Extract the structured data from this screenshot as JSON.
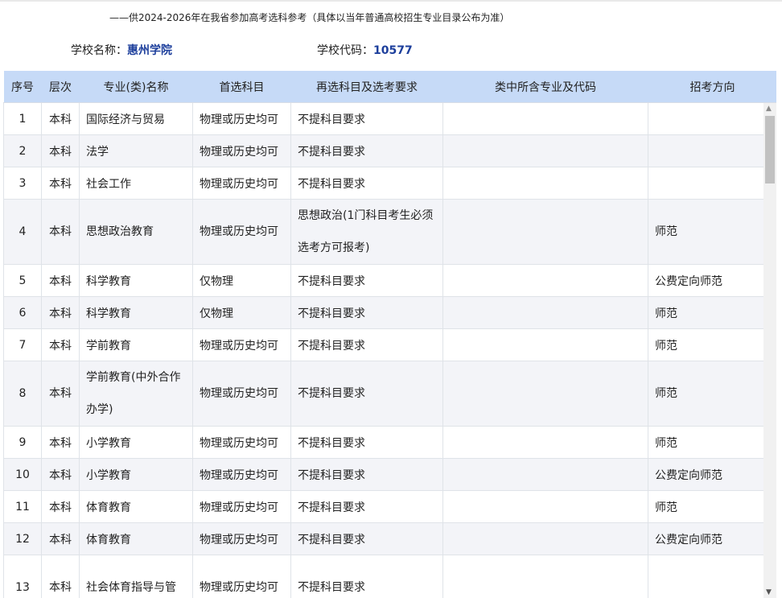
{
  "subtitle": "——供2024-2026年在我省参加高考选科参考（具体以当年普通高校招生专业目录公布为准）",
  "school": {
    "name_label": "学校名称：",
    "name": "惠州学院",
    "code_label": "学校代码：",
    "code": "10577"
  },
  "table": {
    "headers": [
      "序号",
      "层次",
      "专业(类)名称",
      "首选科目",
      "再选科目及选考要求",
      "类中所含专业及代码",
      "招考方向"
    ],
    "rows": [
      [
        "1",
        "本科",
        "国际经济与贸易",
        "物理或历史均可",
        "不提科目要求",
        "",
        ""
      ],
      [
        "2",
        "本科",
        "法学",
        "物理或历史均可",
        "不提科目要求",
        "",
        ""
      ],
      [
        "3",
        "本科",
        "社会工作",
        "物理或历史均可",
        "不提科目要求",
        "",
        ""
      ],
      [
        "4",
        "本科",
        "思想政治教育",
        "物理或历史均可",
        "思想政治(1门科目考生必须选考方可报考)",
        "",
        "师范"
      ],
      [
        "5",
        "本科",
        "科学教育",
        "仅物理",
        "不提科目要求",
        "",
        "公费定向师范"
      ],
      [
        "6",
        "本科",
        "科学教育",
        "仅物理",
        "不提科目要求",
        "",
        "师范"
      ],
      [
        "7",
        "本科",
        "学前教育",
        "物理或历史均可",
        "不提科目要求",
        "",
        "师范"
      ],
      [
        "8",
        "本科",
        "学前教育(中外合作办学)",
        "物理或历史均可",
        "不提科目要求",
        "",
        "师范"
      ],
      [
        "9",
        "本科",
        "小学教育",
        "物理或历史均可",
        "不提科目要求",
        "",
        "师范"
      ],
      [
        "10",
        "本科",
        "小学教育",
        "物理或历史均可",
        "不提科目要求",
        "",
        "公费定向师范"
      ],
      [
        "11",
        "本科",
        "体育教育",
        "物理或历史均可",
        "不提科目要求",
        "",
        "师范"
      ],
      [
        "12",
        "本科",
        "体育教育",
        "物理或历史均可",
        "不提科目要求",
        "",
        "公费定向师范"
      ],
      [
        "13",
        "本科",
        "社会体育指导与管",
        "物理或历史均可",
        "不提科目要求",
        "",
        ""
      ]
    ]
  },
  "icons": {
    "scroll_up": "triangle-up-icon",
    "scroll_down": "triangle-down-icon"
  },
  "colors": {
    "header_bg": "#c6daf7",
    "accent_text": "#1d3f9c",
    "alt_row_bg": "#f3f4f8"
  }
}
